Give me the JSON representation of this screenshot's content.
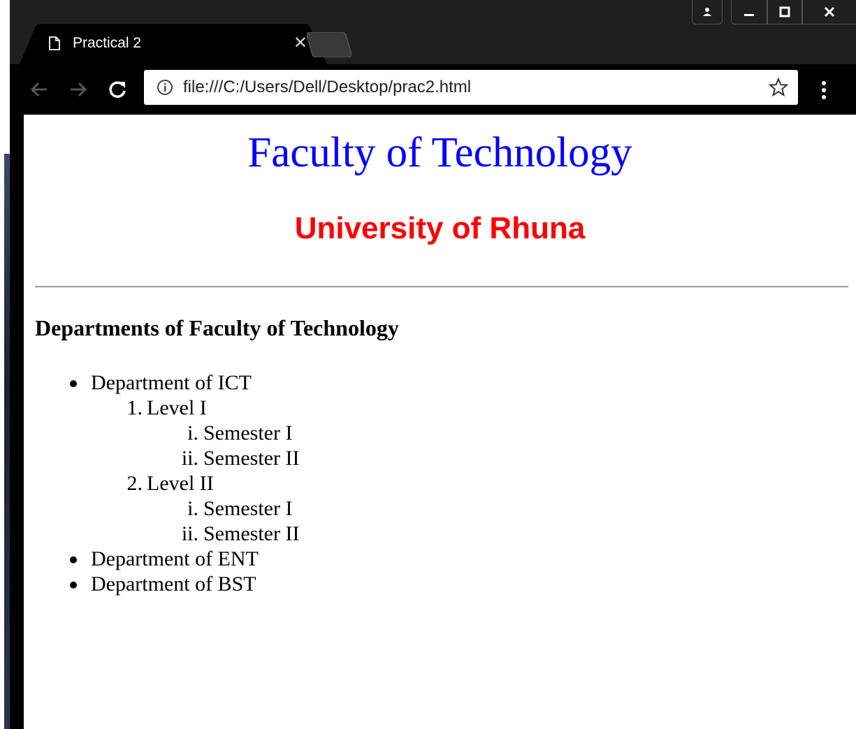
{
  "tab": {
    "title": "Practical 2"
  },
  "address_bar": {
    "url": "file:///C:/Users/Dell/Desktop/prac2.html"
  },
  "page": {
    "heading": "Faculty of Technology",
    "subheading": "University of Rhuna",
    "section_title": "Departments of Faculty of Technology",
    "departments": [
      {
        "label": "Department of ICT",
        "levels": [
          {
            "marker": "1.",
            "label": "Level I",
            "semesters": [
              {
                "marker": "i.",
                "label": "Semester I"
              },
              {
                "marker": "ii.",
                "label": "Semester II"
              }
            ]
          },
          {
            "marker": "2.",
            "label": "Level II",
            "semesters": [
              {
                "marker": "i.",
                "label": "Semester I"
              },
              {
                "marker": "ii.",
                "label": "Semester II"
              }
            ]
          }
        ]
      },
      {
        "label": "Department of ENT"
      },
      {
        "label": "Department of BST"
      }
    ]
  },
  "colors": {
    "heading": "#0000ff",
    "subheading": "#ff0000",
    "chrome": "#000000"
  }
}
